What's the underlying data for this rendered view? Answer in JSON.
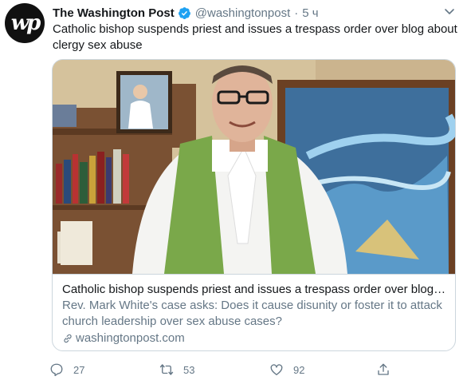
{
  "tweet": {
    "avatar_text": "wp",
    "author_name": "The Washington Post",
    "handle": "@washingtonpost",
    "separator": "·",
    "time": "5 ч",
    "text": "Catholic bishop suspends priest and issues a trespass order over blog about clergy sex abuse"
  },
  "card": {
    "title": "Catholic bishop suspends priest and issues a trespass order over blog a...",
    "description": "Rev. Mark White's case asks: Does it cause disunity or foster it to attack church leadership over sex abuse cases?",
    "domain": "washingtonpost.com",
    "image_icon": "photo-priest-in-green-stole"
  },
  "actions": {
    "reply_count": "27",
    "retweet_count": "53",
    "like_count": "92"
  },
  "colors": {
    "text": "#14171a",
    "secondary": "#657786",
    "border": "#ccd6dd",
    "verified": "#1da1f2",
    "stole": "#7aa84a"
  }
}
